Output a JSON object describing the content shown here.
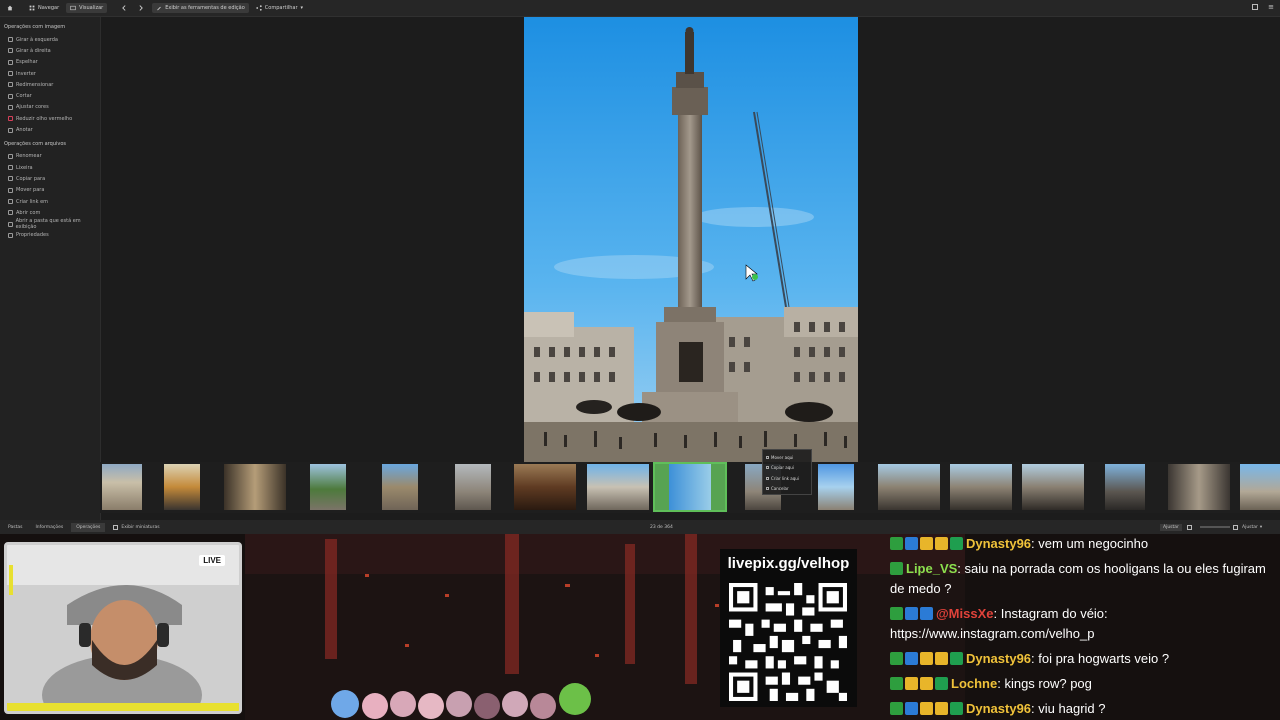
{
  "toolbar": {
    "navigate_label": "Navegar",
    "view_label": "Visualizar",
    "edit_tools_label": "Exibir as ferramentas de edição",
    "share_label": "Compartilhar"
  },
  "sidebar": {
    "image_ops_title": "Operações com imagem",
    "image_ops": [
      {
        "label": "Girar à esquerda",
        "icon": "rotate-left-icon"
      },
      {
        "label": "Girar à direita",
        "icon": "rotate-right-icon"
      },
      {
        "label": "Espelhar",
        "icon": "mirror-icon"
      },
      {
        "label": "Inverter",
        "icon": "flip-icon"
      },
      {
        "label": "Redimensionar",
        "icon": "resize-icon"
      },
      {
        "label": "Cortar",
        "icon": "crop-icon"
      },
      {
        "label": "Ajustar cores",
        "icon": "color-icon"
      },
      {
        "label": "Reduzir olho vermelho",
        "icon": "red-eye-icon"
      },
      {
        "label": "Anotar",
        "icon": "annotate-icon"
      }
    ],
    "file_ops_title": "Operações com arquivos",
    "file_ops": [
      {
        "label": "Renomear",
        "icon": "rename-icon"
      },
      {
        "label": "Lixeira",
        "icon": "trash-icon"
      },
      {
        "label": "Copiar para",
        "icon": "copy-icon"
      },
      {
        "label": "Mover para",
        "icon": "move-icon"
      },
      {
        "label": "Criar link em",
        "icon": "link-icon"
      },
      {
        "label": "Abrir com",
        "icon": "open-with-icon"
      },
      {
        "label": "Abrir a pasta que está em exibição",
        "icon": "folder-icon"
      },
      {
        "label": "Propriedades",
        "icon": "properties-icon"
      }
    ]
  },
  "context_menu": [
    "Mover aqui",
    "Copiar aqui",
    "Criar link aqui",
    "Cancelar"
  ],
  "statusbar": {
    "tabs": [
      "Pastas",
      "Informações",
      "Operações"
    ],
    "active_tab": "Operações",
    "thumbnails_label": "Exibir miniaturas",
    "counter": "23 de 364",
    "fit_label": "Ajustar",
    "zoom_label": "Ajustar"
  },
  "thumbnail_strip": {
    "selected_index": 8
  },
  "stream": {
    "live_label": "LIVE",
    "qr_title": "livepix.gg/velhop",
    "chat": [
      {
        "user": "Dynasty96",
        "color": "#f0c23a",
        "text": ": vem um negocinho",
        "badges": [
          "#2e9e3e",
          "#2b7bd6",
          "#e8b52a",
          "#e8b52a",
          "#1f9e4f"
        ]
      },
      {
        "user": "Lipe_VS",
        "color": "#8be04e",
        "text": ": saiu na porrada com os hooligans la ou eles fugiram de medo ?",
        "badges": [
          "#2e9e3e"
        ]
      },
      {
        "user": "@MissXe",
        "color": "#e0423a",
        "text": ": Instagram do véio: https://www.instagram.com/velho_p",
        "badges": [
          "#2e9e3e",
          "#2b7bd6",
          "#2b7bd6"
        ]
      },
      {
        "user": "Dynasty96",
        "color": "#f0c23a",
        "text": ": foi pra hogwarts veio ?",
        "badges": [
          "#2e9e3e",
          "#2b7bd6",
          "#e8b52a",
          "#e8b52a",
          "#1f9e4f"
        ]
      },
      {
        "user": "Lochne",
        "color": "#f0c23a",
        "text": ": kings row? pog",
        "badges": [
          "#2e9e3e",
          "#e8b52a",
          "#e8b52a",
          "#1f9e4f"
        ]
      },
      {
        "user": "Dynasty96",
        "color": "#f0c23a",
        "text": ": viu hagrid ?",
        "badges": [
          "#2e9e3e",
          "#2b7bd6",
          "#e8b52a",
          "#e8b52a",
          "#1f9e4f"
        ]
      }
    ]
  }
}
